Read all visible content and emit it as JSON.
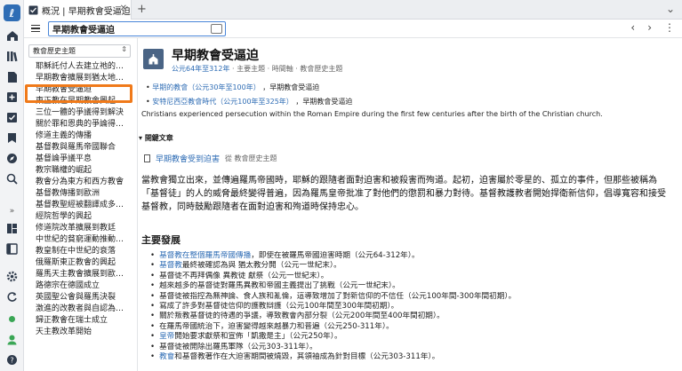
{
  "tab": {
    "title": "概況 | 早期教會受逼迫"
  },
  "search": {
    "value": "早期教會受逼迫"
  },
  "sidebar": {
    "dropdown_label": "教會歷史主題",
    "items": [
      "耶穌託付人去建立祂的…",
      "早期教會擴展到猶太地…",
      "早期教會受逼迫",
      "東正教在早期教會興起",
      "三位一體的爭議得到解決",
      "關於罪和恩典的爭論得…",
      "修道主義的傳播",
      "基督教與羅馬帝國聯合",
      "基督論爭議平息",
      "教宗職權的崛起",
      "教會分為東方和西方教會",
      "基督教傳播到歐洲",
      "基督教聖經被翻譯成多…",
      "經院哲學的興起",
      "修道院改革擴展到教廷",
      "中世紀的貧窮運動推動…",
      "教皇制在中世紀的衰落",
      "俄羅斯東正教會的興起",
      "羅馬天主教會擴展到歐…",
      "路德宗在德國成立",
      "英國聖公會與羅馬決裂",
      "激進的改教者與自認為…",
      "歸正教會在瑞士成立",
      "天主教改革開始"
    ]
  },
  "main": {
    "title": "早期教會受逼迫",
    "meta_date": "公元64年至312年",
    "meta_rest": " · 主要主題 · 時間軸 · 教會歷史主題",
    "rel1_link": "早期的教會（公元30年至100年）",
    "rel1_rest": " ，早期教會受逼迫",
    "rel2_link": "安特尼西亞教會時代（公元100年至325年）",
    "rel2_rest": " ，早期教會受逼迫",
    "description": "Christians experienced persecution within the Roman Empire during the first few centuries after the birth of the Christian church.",
    "section_label": "開鍵文章",
    "article_link": "早期教會受到迫害",
    "article_from": "從 教會歷史主題",
    "body": "當教會獨立出來，並傳遍羅馬帝國時，耶穌的跟隨者面對迫害和被殺害而殉道。起初，迫害屬於零星的、孤立的事件，但那些被稱為「基督徒」的人的威脅最終變得普遍，因為羅馬皇帝批准了對他們的懲罰和暴力對待。基督教護教者開始捍衛新信仰，倡導寬容和接受基督教，同時鼓勵跟隨者在面對迫害和殉道時保持忠心。",
    "heading": "主要發展",
    "bullets": [
      {
        "link": "基督教在整個羅馬帝國傳播",
        "rest": "，即使在被羅馬帝國迫害時期（公元64-312年）。"
      },
      {
        "link": "基督教",
        "rest": "最終被確認為與 猶太教分開（公元一世紀末）。"
      },
      {
        "link": "",
        "rest": "基督徒不再拜偶像 異教徒 獻祭（公元一世紀末）。"
      },
      {
        "link": "",
        "rest": "越來越多的基督徒對羅馬異教和帝國主義提出了挑戰（公元一世紀末）。"
      },
      {
        "link": "",
        "rest": "基督徒被指控為無神論、食人族和亂倫，這導致增加了對新信仰的不信任（公元100年間-300年間初期）。"
      },
      {
        "link": "",
        "rest": "寫成了許多對基督徒信仰的護教辯護（公元100年間至300年間初期）。"
      },
      {
        "link": "",
        "rest": "關於叛教基督徒的待遇的爭議，導致教會內部分裂（公元200年間至400年間初期）。"
      },
      {
        "link": "",
        "rest": "在羅馬帝國統治下，迫害變得越來越暴力和普遍（公元250-311年）。"
      },
      {
        "link": "皇帝",
        "rest": "開始要求獻祭和宣佈「凱撒是主」（公元250年）。"
      },
      {
        "link": "",
        "rest": "基督徒被開除出羅馬軍隊（公元303-311年）。"
      },
      {
        "link": "教會",
        "rest": "和基督教著作在大迫害期間被燒毀，其領袖成為針對目標（公元303-311年）。"
      }
    ]
  }
}
